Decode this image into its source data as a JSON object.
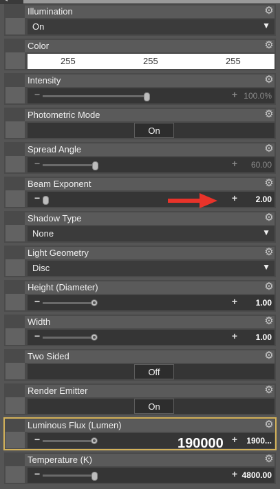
{
  "panel": {
    "properties": [
      {
        "label": "Illumination",
        "type": "dropdown",
        "value": "On"
      },
      {
        "label": "Color",
        "type": "color",
        "values": [
          "255",
          "255",
          "255"
        ]
      },
      {
        "label": "Intensity",
        "type": "slider",
        "value": "100.0%",
        "level_percent": 100,
        "dim": true,
        "knob": "thumb"
      },
      {
        "label": "Photometric Mode",
        "type": "toggle",
        "value": "On"
      },
      {
        "label": "Spread Angle",
        "type": "slider",
        "value": "60.00",
        "level_percent": 50,
        "dim": true,
        "knob": "thumb"
      },
      {
        "label": "Beam Exponent",
        "type": "slider",
        "value": "2.00",
        "level_percent": 2,
        "dim": false,
        "knob": "thumb"
      },
      {
        "label": "Shadow Type",
        "type": "dropdown",
        "value": "None"
      },
      {
        "label": "Light Geometry",
        "type": "dropdown",
        "value": "Disc"
      },
      {
        "label": "Height (Diameter)",
        "type": "slider",
        "value": "1.00",
        "level_percent": 50,
        "dim": false,
        "knob": "dot"
      },
      {
        "label": "Width",
        "type": "slider",
        "value": "1.00",
        "level_percent": 50,
        "dim": false,
        "knob": "dot"
      },
      {
        "label": "Two Sided",
        "type": "toggle",
        "value": "Off"
      },
      {
        "label": "Render Emitter",
        "type": "toggle",
        "value": "On"
      },
      {
        "label": "Luminous Flux (Lumen)",
        "type": "slider",
        "value": "1900...",
        "level_percent": 50,
        "dim": false,
        "knob": "dot",
        "selected": true
      },
      {
        "label": "Temperature (K)",
        "type": "slider",
        "value": "4800.00",
        "level_percent": 49,
        "dim": false,
        "knob": "thumb"
      }
    ]
  },
  "annotation": {
    "arrow_color": "#e8332a",
    "big_value": "190000"
  },
  "icons": {
    "gear": "gear-icon",
    "dropdown": "chevron-down-icon"
  }
}
